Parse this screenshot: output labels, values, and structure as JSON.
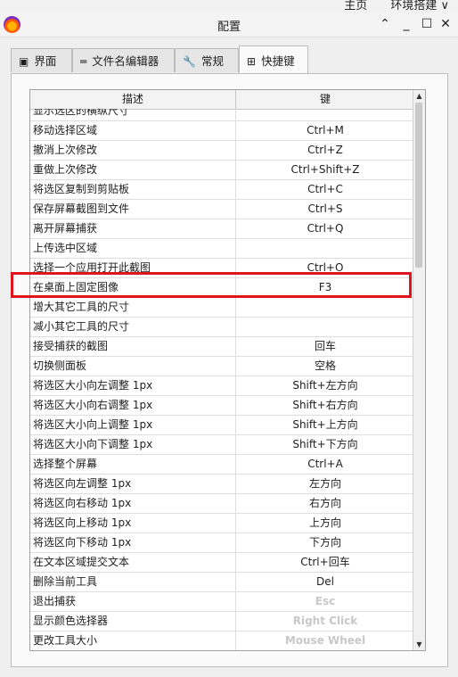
{
  "topbar": {
    "link1": "主页",
    "link2": "环境搭建 ∨"
  },
  "window": {
    "title": "配置",
    "controls": {
      "up": "⌃",
      "minimize": "_",
      "maximize": "☐",
      "close": "✕"
    }
  },
  "tabs": [
    {
      "icon": "▣",
      "label": "界面"
    },
    {
      "icon": "═",
      "label": "文件名编辑器"
    },
    {
      "icon": "🔧",
      "label": "常规"
    },
    {
      "icon": "⊞",
      "label": "快捷键"
    }
  ],
  "active_tab": "快捷键",
  "table": {
    "headers": {
      "description": "描述",
      "key": "键"
    },
    "rows": [
      {
        "desc": "显示选区的横纵尺寸",
        "key": ""
      },
      {
        "desc": "移动选择区域",
        "key": "Ctrl+M"
      },
      {
        "desc": "撤消上次修改",
        "key": "Ctrl+Z"
      },
      {
        "desc": "重做上次修改",
        "key": "Ctrl+Shift+Z"
      },
      {
        "desc": "将选区复制到剪贴板",
        "key": "Ctrl+C"
      },
      {
        "desc": "保存屏幕截图到文件",
        "key": "Ctrl+S"
      },
      {
        "desc": "离开屏幕捕获",
        "key": "Ctrl+Q"
      },
      {
        "desc": "上传选中区域",
        "key": ""
      },
      {
        "desc": "选择一个应用打开此截图",
        "key": "Ctrl+O"
      },
      {
        "desc": "在桌面上固定图像",
        "key": "F3"
      },
      {
        "desc": "增大其它工具的尺寸",
        "key": ""
      },
      {
        "desc": "减小其它工具的尺寸",
        "key": ""
      },
      {
        "desc": "接受捕获的截图",
        "key": "回车"
      },
      {
        "desc": "切换侧面板",
        "key": "空格"
      },
      {
        "desc": "将选区大小向左调整 1px",
        "key": "Shift+左方向"
      },
      {
        "desc": "将选区大小向右调整 1px",
        "key": "Shift+右方向"
      },
      {
        "desc": "将选区大小向上调整 1px",
        "key": "Shift+上方向"
      },
      {
        "desc": "将选区大小向下调整 1px",
        "key": "Shift+下方向"
      },
      {
        "desc": "选择整个屏幕",
        "key": "Ctrl+A"
      },
      {
        "desc": "将选区向左调整 1px",
        "key": "左方向"
      },
      {
        "desc": "将选区向右移动 1px",
        "key": "右方向"
      },
      {
        "desc": "将选区向上移动 1px",
        "key": "上方向"
      },
      {
        "desc": "将选区向下移动 1px",
        "key": "下方向"
      },
      {
        "desc": "在文本区域提交文本",
        "key": "Ctrl+回车"
      },
      {
        "desc": "删除当前工具",
        "key": "Del"
      },
      {
        "desc": "退出捕获",
        "key": "Esc",
        "dim": true
      },
      {
        "desc": "显示颜色选择器",
        "key": "Right Click",
        "dim": true
      },
      {
        "desc": "更改工具大小",
        "key": "Mouse Wheel",
        "dim": true
      }
    ],
    "highlighted_row": "在桌面上固定图像"
  },
  "scrollbar": {
    "up": "▲",
    "down": "▼"
  },
  "colors": {
    "highlight_border": "#e0141c",
    "dim_key": "#c8c8c8"
  }
}
